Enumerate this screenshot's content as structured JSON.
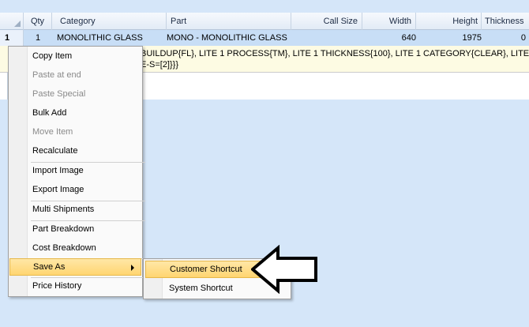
{
  "grid": {
    "columns": [
      {
        "label": "Qty",
        "name": "col-qty"
      },
      {
        "label": "Category",
        "name": "col-category"
      },
      {
        "label": "Part",
        "name": "col-part"
      },
      {
        "label": "Call Size",
        "name": "col-call-size"
      },
      {
        "label": "Width",
        "name": "col-width"
      },
      {
        "label": "Height",
        "name": "col-height"
      },
      {
        "label": "Thickness",
        "name": "col-thickness"
      }
    ],
    "row1": {
      "num": "1",
      "qty": "1",
      "category": "MONOLITHIC GLASS",
      "part": "MONO - MONOLITHIC GLASS",
      "width": "640",
      "height": "1975",
      "thickness": "0"
    },
    "detail_line1": "BUILDUP{FL}, LITE 1 PROCESS{TM}, LITE 1 THICKNESS{100}, LITE 1 CATEGORY{CLEAR}, LITE 1 TYPE",
    "detail_line2": "E-S=[2]}}}"
  },
  "context_menu": {
    "items": [
      {
        "label": "Copy Item"
      },
      {
        "label": "Paste at end"
      },
      {
        "label": "Paste Special"
      },
      {
        "label": "Bulk Add"
      },
      {
        "label": "Move Item"
      },
      {
        "label": "Recalculate"
      },
      {
        "label": "Import Image"
      },
      {
        "label": "Export Image"
      },
      {
        "label": "Multi Shipments"
      },
      {
        "label": "Part Breakdown"
      },
      {
        "label": "Cost Breakdown"
      },
      {
        "label": "Save As"
      },
      {
        "label": "Price History"
      }
    ]
  },
  "submenu": {
    "items": [
      {
        "label": "Customer Shortcut"
      },
      {
        "label": "System Shortcut"
      }
    ]
  },
  "colors": {
    "background": "#d5e6f9",
    "selected_row": "#c8def6",
    "menu_highlight": "#ffd571",
    "detail_background": "#fdfbe3"
  },
  "icons": {
    "pointer": "hollow-left-arrow-icon",
    "submenu": "chevron-right-icon"
  }
}
